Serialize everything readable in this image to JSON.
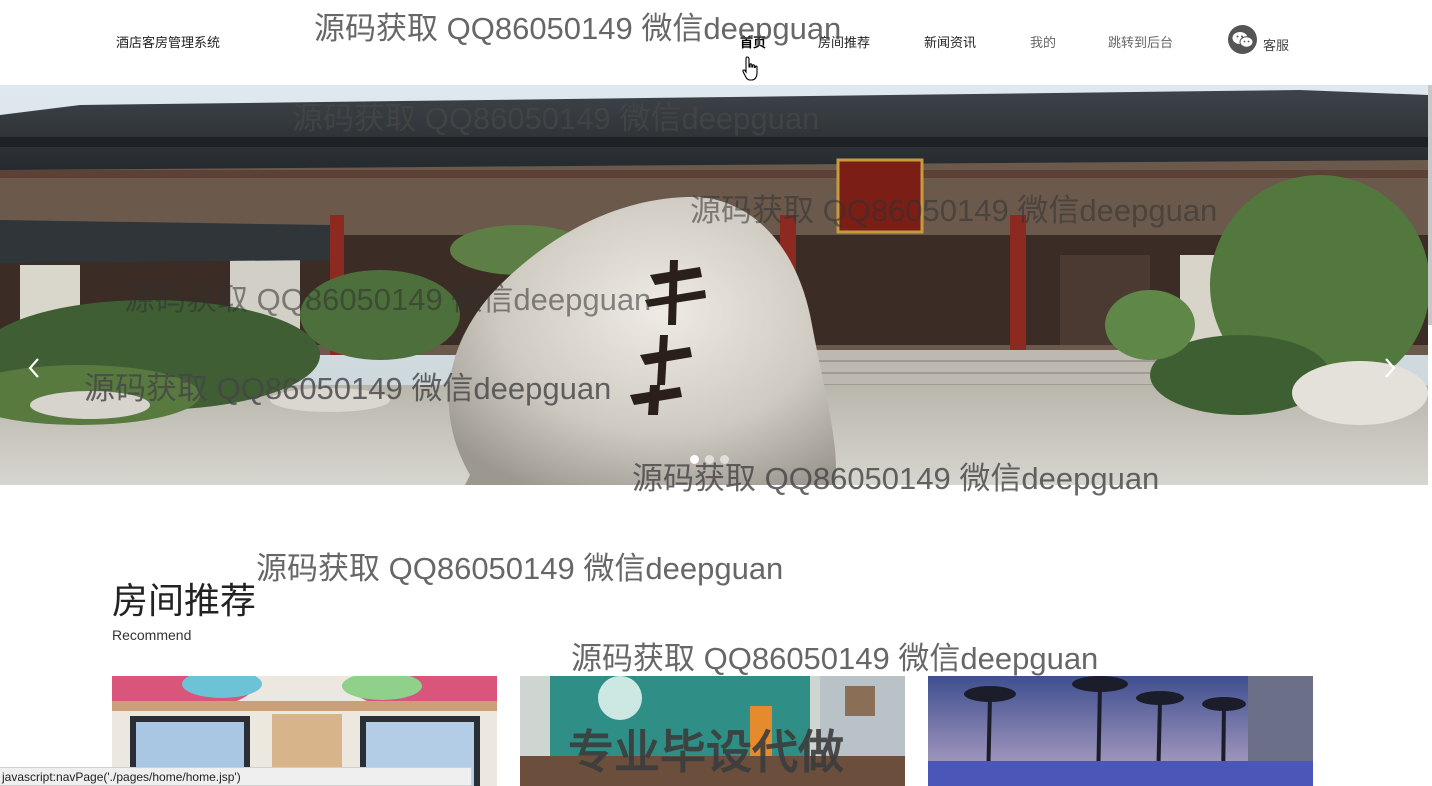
{
  "header": {
    "brand": "酒店客房管理系统",
    "nav": [
      {
        "label": "首页"
      },
      {
        "label": "房间推荐"
      },
      {
        "label": "新闻资讯"
      },
      {
        "label": "我的"
      },
      {
        "label": "跳转到后台"
      }
    ],
    "service_label": "客服",
    "service_icon": "wechat-icon"
  },
  "banner": {
    "prev_icon": "chevron-left-icon",
    "next_icon": "chevron-right-icon",
    "slide_count": 3,
    "active_slide": 1
  },
  "section": {
    "title": "房间推荐",
    "subtitle": "Recommend"
  },
  "watermarks": {
    "text": "源码获取 QQ86050149 微信deepguan",
    "promo": "专业毕设代做"
  },
  "status_bar": {
    "text": "javascript:navPage('./pages/home/home.jsp')"
  },
  "colors": {
    "accent": "#000000",
    "status_bg": "#efefef"
  }
}
